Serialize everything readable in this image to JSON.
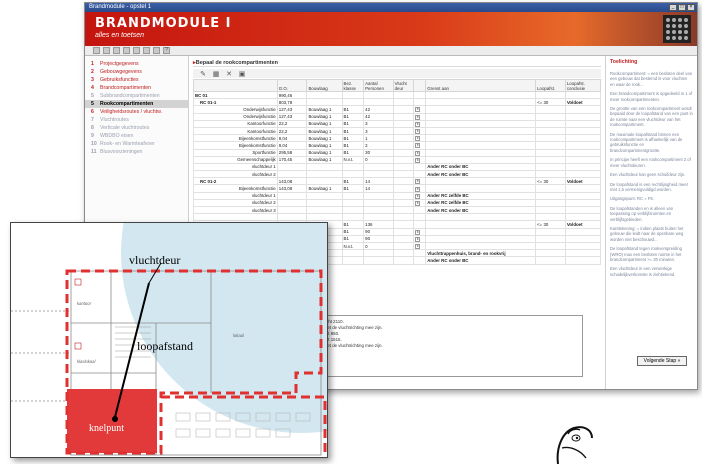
{
  "window": {
    "title": "Brandmodule - opstel 1",
    "banner_title": "BRANDMODULE I",
    "banner_sub": "alles en toetsen"
  },
  "nav": {
    "items": [
      {
        "num": "1",
        "label": "Projectgegevens",
        "state": "normal"
      },
      {
        "num": "2",
        "label": "Gebouwgegevens",
        "state": "normal"
      },
      {
        "num": "3",
        "label": "Gebruiksfuncties",
        "state": "normal"
      },
      {
        "num": "4",
        "label": "Brandcompartimenten",
        "state": "normal"
      },
      {
        "num": "5",
        "label": "Subbrandcompartimenten",
        "state": "dim"
      },
      {
        "num": "5",
        "label": "Rookcompartimenten",
        "state": "active"
      },
      {
        "num": "6",
        "label": "Veiligheidsroutes / vluchtw.",
        "state": "normal"
      },
      {
        "num": "7",
        "label": "Vluchtroutes",
        "state": "dim"
      },
      {
        "num": "8",
        "label": "Verticale vluchtroutes",
        "state": "dim"
      },
      {
        "num": "9",
        "label": "WBDBO eisen",
        "state": "dim"
      },
      {
        "num": "10",
        "label": "Rook- en Warmteafvoer",
        "state": "dim"
      },
      {
        "num": "11",
        "label": "Blusvoorzieningen",
        "state": "dim"
      }
    ]
  },
  "content": {
    "section_title": "Bepaal de rookcompartimenten",
    "columns": [
      "",
      "G.O.",
      "Bouwlaag",
      "Bez. klasse",
      "Aantal Personen",
      "Vlucht deur",
      "",
      "Grenst aan",
      "Loopafst.",
      "Loopafst. conclusie"
    ],
    "rows": [
      {
        "name": "BC 01",
        "go": "990,46",
        "bl": "",
        "bk": "",
        "ap": "",
        "vd": "",
        "c": "",
        "ga": "",
        "la": "",
        "lc": "",
        "bold": true
      },
      {
        "name": "RC 01-1",
        "go": "803,78",
        "bl": "",
        "bk": "",
        "ap": "",
        "vd": "",
        "c": "",
        "ga": "",
        "la": "<= 30",
        "lc": "Voldoet",
        "bold": true
      },
      {
        "name": "Onderwijsfunctie",
        "go": "127,43",
        "bl": "Bouwlaag 1",
        "bk": "B1",
        "ap": "42",
        "vd": "",
        "c": "x",
        "ga": "",
        "la": "",
        "lc": "",
        "bold": false
      },
      {
        "name": "Onderwijsfunctie",
        "go": "127,43",
        "bl": "Bouwlaag 1",
        "bk": "B1",
        "ap": "42",
        "vd": "",
        "c": "x",
        "ga": "",
        "la": "",
        "lc": "",
        "bold": false
      },
      {
        "name": "Kantoorfunctie",
        "go": "22,2",
        "bl": "Bouwlaag 1",
        "bk": "B1",
        "ap": "3",
        "vd": "",
        "c": "x",
        "ga": "",
        "la": "",
        "lc": "",
        "bold": false
      },
      {
        "name": "Kantoorfunctie",
        "go": "22,2",
        "bl": "Bouwlaag 1",
        "bk": "B1",
        "ap": "3",
        "vd": "",
        "c": "x",
        "ga": "",
        "la": "",
        "lc": "",
        "bold": false
      },
      {
        "name": "Bijeenkomstfunctie",
        "go": "9,04",
        "bl": "Bouwlaag 1",
        "bk": "B1",
        "ap": "1",
        "vd": "",
        "c": "x",
        "ga": "",
        "la": "",
        "lc": "",
        "bold": false
      },
      {
        "name": "Bijeenkomstfunctie",
        "go": "9,04",
        "bl": "Bouwlaag 1",
        "bk": "B1",
        "ap": "2",
        "vd": "",
        "c": "x",
        "ga": "",
        "la": "",
        "lc": "",
        "bold": false
      },
      {
        "name": "Sportfunctie",
        "go": "295,58",
        "bl": "Bouwlaag 1",
        "bk": "B1",
        "ap": "30",
        "vd": "",
        "c": "x",
        "ga": "",
        "la": "",
        "lc": "",
        "bold": false
      },
      {
        "name": "Gemeenschappelijk",
        "go": "170,45",
        "bl": "Bouwlaag 1",
        "bk": "N.v.t.",
        "ap": "0",
        "vd": "",
        "c": "x",
        "ga": "",
        "la": "",
        "lc": "",
        "bold": false
      },
      {
        "name": "vluchtdeur 1",
        "go": "",
        "bl": "",
        "bk": "",
        "ap": "",
        "vd": "",
        "c": "",
        "ga": "Ander RC onder BC",
        "la": "",
        "lc": "",
        "bold": false
      },
      {
        "name": "vluchtdeur 2",
        "go": "",
        "bl": "",
        "bk": "",
        "ap": "",
        "vd": "",
        "c": "",
        "ga": "Ander RC onder BC",
        "la": "",
        "lc": "",
        "bold": false
      },
      {
        "name": "RC 01-2",
        "go": "143,08",
        "bl": "",
        "bk": "B1",
        "ap": "14",
        "vd": "",
        "c": "x",
        "ga": "",
        "la": "<= 30",
        "lc": "Voldoet",
        "bold": true
      },
      {
        "name": "Bijeenkomstfunctie",
        "go": "143,08",
        "bl": "Bouwlaag 1",
        "bk": "B1",
        "ap": "14",
        "vd": "",
        "c": "x",
        "ga": "",
        "la": "",
        "lc": "",
        "bold": false
      },
      {
        "name": "vluchtdeur 1",
        "go": "",
        "bl": "",
        "bk": "",
        "ap": "",
        "vd": "",
        "c": "x",
        "ga": "Ander RC zelfde BC",
        "la": "",
        "lc": "",
        "bold": false
      },
      {
        "name": "vluchtdeur 2",
        "go": "",
        "bl": "",
        "bk": "",
        "ap": "",
        "vd": "",
        "c": "x",
        "ga": "Ander RC zelfde BC",
        "la": "",
        "lc": "",
        "bold": false
      },
      {
        "name": "vluchtdeur 3",
        "go": "",
        "bl": "",
        "bk": "",
        "ap": "",
        "vd": "",
        "c": "",
        "ga": "Ander RC onder BC",
        "la": "",
        "lc": "",
        "bold": false
      },
      {
        "name": "",
        "go": "",
        "bl": "",
        "bk": "",
        "ap": "",
        "vd": "",
        "c": "",
        "ga": "",
        "la": "",
        "lc": "",
        "bold": false
      },
      {
        "name": "",
        "go": "",
        "bl": "",
        "bk": "B1",
        "ap": "136",
        "vd": "",
        "c": "",
        "ga": "",
        "la": "<= 30",
        "lc": "Voldoet",
        "bold": false
      },
      {
        "name": "",
        "go": "",
        "bl": "",
        "bk": "B1",
        "ap": "90",
        "vd": "",
        "c": "x",
        "ga": "",
        "la": "",
        "lc": "",
        "bold": false
      },
      {
        "name": "",
        "go": "",
        "bl": "",
        "bk": "B1",
        "ap": "90",
        "vd": "",
        "c": "x",
        "ga": "",
        "la": "",
        "lc": "",
        "bold": false
      },
      {
        "name": "",
        "go": "",
        "bl": "",
        "bk": "N.v.t.",
        "ap": "0",
        "vd": "",
        "c": "x",
        "ga": "",
        "la": "",
        "lc": "",
        "bold": false
      },
      {
        "name": "",
        "go": "",
        "bl": "",
        "bk": "",
        "ap": "",
        "vd": "",
        "c": "",
        "ga": "Vluchttrappenhuis, brand- en rookvrij",
        "la": "",
        "lc": "",
        "bold": false
      },
      {
        "name": "",
        "go": "",
        "bl": "",
        "bk": "",
        "ap": "",
        "vd": "",
        "c": "",
        "ga": "Ander RC onder BC",
        "la": "",
        "lc": "",
        "bold": false
      }
    ],
    "next_button": "Volgende Stap »",
    "hints": [
      "...ucht 2110.",
      "...met de vluchtrichting mee zijn.",
      "...kgt 850.",
      "...kgt 1515.",
      "...met de vluchtrichting mee zijn."
    ]
  },
  "help": {
    "title": "Toelichting",
    "paragraphs": [
      "Rookcompartiment: = een besloten deel van een gebouw dat bestemd is voor vluchten en waar de rook...",
      "Een brandcompartiment is opgedeeld in 1 of meer rookcompartimenten.",
      "De grootte van een rookcompartiment wordt bepaald door de loopafstand van een punt in de ruimte naar een vluchtdeur van het rookcompartiment.",
      "De maximale loopafstand binnen een rookcompartiment is afhankelijk van de gebruiksfunctie en brandcompartimentgrootte.",
      "In principe heeft een rookcompartiment 2 of meer vluchtdeuren.",
      "Een vluchtdeur kan geen schuifdeur zijn.",
      "De loopafstand is een rechtlijnigheid meet met 1,5 vermenigvuldigd worden.",
      "Uitgangspunt: RC = F6.",
      "De loopafstanden en is alleen van toepassing op verblijfsruimten en verblijfsgebieden.",
      "Kanttekening: = indien plaats buiten het gebouw die leidt naar de openbare weg worden niet beschouwd...",
      "De loopafstand tegen rookverspreiding (WRO) max een besloten ruimte in het brandcompartiment >= 30 minuten.",
      "Een vluchtdeur in een verwerkige schadelijkverkomste is ziehtiekend."
    ]
  },
  "plan": {
    "label_door": "vluchtdeur",
    "label_distance": "loopafstand",
    "label_knelpunt": "knelpunt",
    "room_labels": [
      "kantoor",
      "klaslokaal",
      "lokaal"
    ]
  },
  "colors": {
    "brand_red": "#c4140f",
    "plan_red": "#e03030",
    "plan_circle": "#d2e7f0",
    "nav_red": "#c02020"
  }
}
